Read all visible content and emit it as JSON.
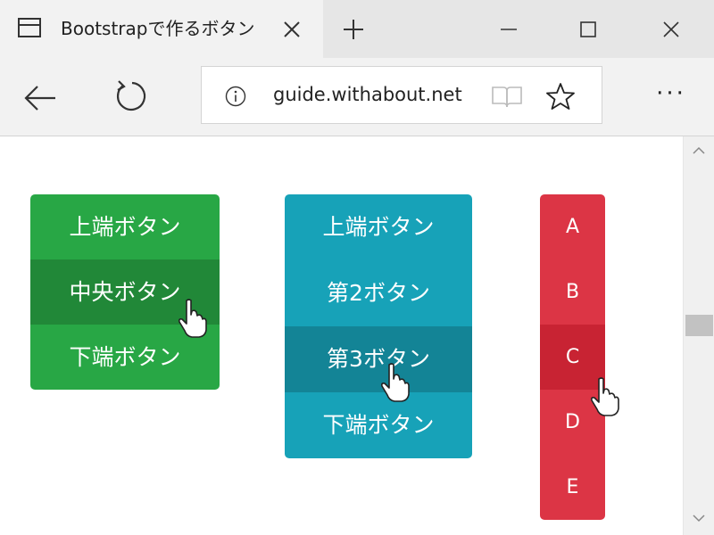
{
  "browser": {
    "tab_title": "Bootstrapで作るボタン",
    "url": "guide.withabout.net"
  },
  "toolbar": {
    "more_label": "···"
  },
  "groups": {
    "green": {
      "color": "#28a745",
      "active_color": "#218838",
      "buttons": [
        "上端ボタン",
        "中央ボタン",
        "下端ボタン"
      ],
      "active_index": 1
    },
    "blue": {
      "color": "#17a2b8",
      "active_color": "#138496",
      "buttons": [
        "上端ボタン",
        "第2ボタン",
        "第3ボタン",
        "下端ボタン"
      ],
      "active_index": 2
    },
    "red": {
      "color": "#dc3545",
      "active_color": "#c82333",
      "buttons": [
        "A",
        "B",
        "C",
        "D",
        "E"
      ],
      "active_index": 2
    }
  },
  "icons": {
    "tab": "page-icon",
    "close": "close-icon",
    "new_tab": "plus-icon",
    "minimize": "minimize-icon",
    "maximize": "maximize-icon",
    "window_close": "close-icon",
    "back": "back-arrow-icon",
    "refresh": "refresh-icon",
    "info": "info-icon",
    "reading_view": "book-icon",
    "favorite": "star-icon",
    "more": "more-icon",
    "cursor": "hand-pointer-icon"
  }
}
